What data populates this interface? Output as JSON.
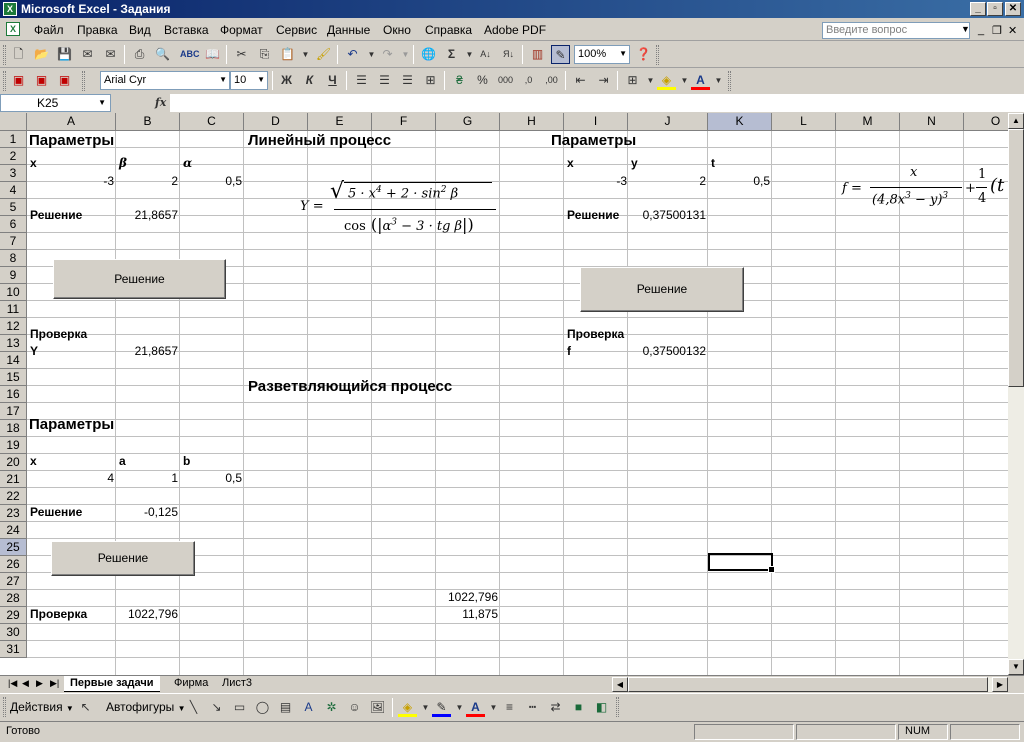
{
  "window": {
    "title": "Microsoft Excel - Задания"
  },
  "menu": [
    "Файл",
    "Правка",
    "Вид",
    "Вставка",
    "Формат",
    "Сервис",
    "Данные",
    "Окно",
    "Справка",
    "Adobe PDF"
  ],
  "help_box": {
    "placeholder": "Введите вопрос"
  },
  "toolbar": {
    "zoom": "100%",
    "font": "Arial Cyr",
    "font_size": "10",
    "thousands": "000"
  },
  "formula_bar": {
    "name_box": "K25",
    "fx": "fx",
    "formula": ""
  },
  "columns": [
    "A",
    "B",
    "C",
    "D",
    "E",
    "F",
    "G",
    "H",
    "I",
    "J",
    "K",
    "L",
    "M",
    "N",
    "O"
  ],
  "rows": [
    "1",
    "2",
    "3",
    "4",
    "5",
    "6",
    "7",
    "8",
    "9",
    "10",
    "11",
    "12",
    "13",
    "14",
    "15",
    "16",
    "17",
    "18",
    "19",
    "20",
    "21",
    "22",
    "23",
    "24",
    "25",
    "26",
    "27",
    "28",
    "29",
    "30",
    "31"
  ],
  "selected": {
    "column": "K",
    "row": "25"
  },
  "cells": {
    "a1": "Параметры",
    "d1": "Линейный процесс",
    "i1": "Параметры",
    "a2": "x",
    "b2": "β",
    "c2": "α",
    "i2": "x",
    "j2": "y",
    "k2": "t",
    "a3": "-3",
    "b3": "2",
    "c3": "0,5",
    "i3": "-3",
    "j3": "2",
    "k3": "0,5",
    "a5": "Решение",
    "b5": "21,8657",
    "i5": "Решение",
    "j5": "0,37500131",
    "a12": "Проверка",
    "i12": "Проверка",
    "a13": "Y",
    "b13": "21,8657",
    "i13": "f",
    "j13": "0,37500132",
    "d15": "Разветвляющийся процесс",
    "a17": "Параметры",
    "a19": "x",
    "b19": "a",
    "c19": "b",
    "a20": "4",
    "b20": "1",
    "c20": "0,5",
    "a22": "Решение",
    "b22": "-0,125",
    "g27": "1022,796",
    "a28": "Проверка",
    "b28": "1022,796",
    "g28": "11,875"
  },
  "buttons": {
    "solve1": "Решение",
    "solve2": "Решение",
    "solve3": "Решение"
  },
  "formulas": {
    "y_lhs": "Y =",
    "y_num_a": "5 · x",
    "y_num_exp": "4",
    "y_num_b": " + 2 · sin",
    "y_num_exp2": "2",
    "y_num_c": " β",
    "y_den_a": "cos",
    "y_den_b": "α",
    "y_den_exp": "3",
    "y_den_c": " − 3 · tg β",
    "f_lhs": "f =",
    "f_num": "x",
    "f_den_a": "(4,8x",
    "f_den_exp": "3",
    "f_den_b": " − y)",
    "f_den_exp2": "3",
    "f_plus": "+",
    "f_frac_num": "1",
    "f_frac_den": "4",
    "f_tail": "(t"
  },
  "sheet_tabs": [
    "Первые задачи",
    "Фирма",
    "Лист3"
  ],
  "drawing": {
    "actions": "Действия",
    "autoshapes": "Автофигуры"
  },
  "status": {
    "ready": "Готово",
    "num": "NUM"
  }
}
